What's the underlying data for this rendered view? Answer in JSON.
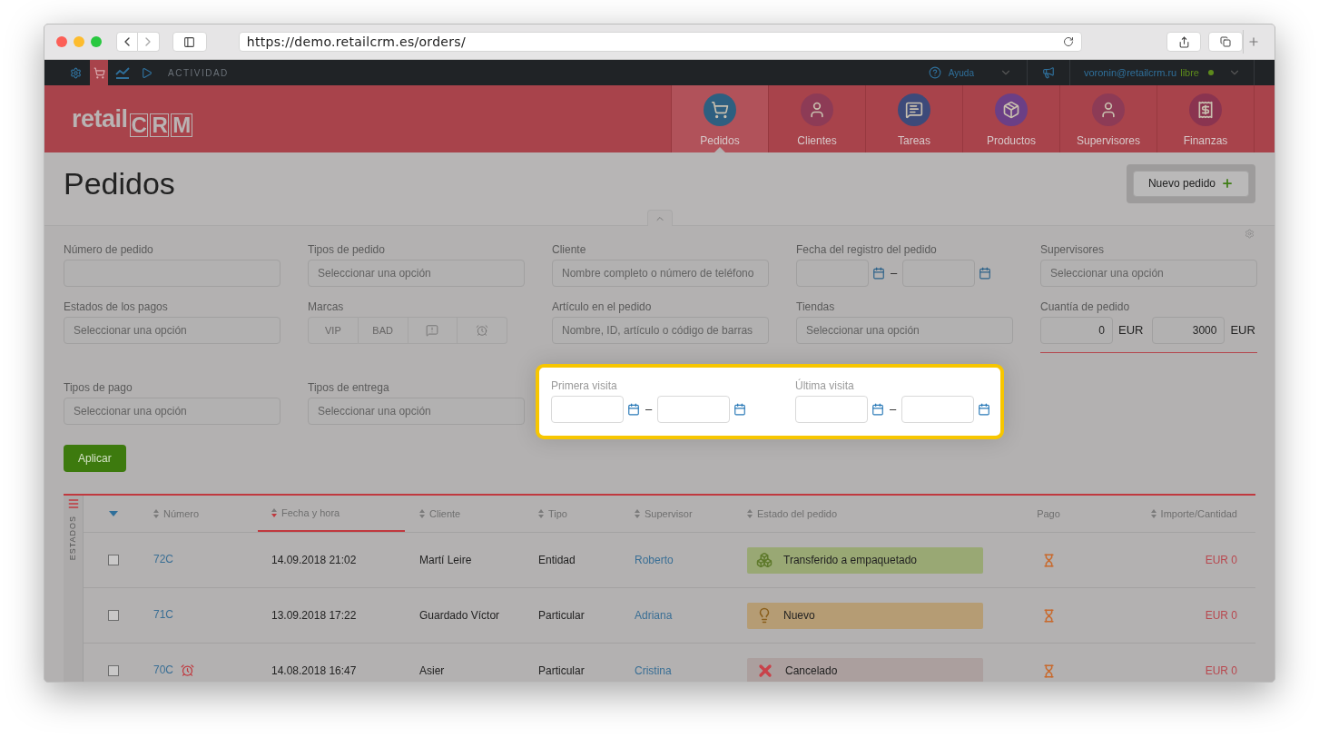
{
  "browser": {
    "url": "https://demo.retailcrm.es/orders/"
  },
  "topbar": {
    "icons": [
      {
        "kind": "gear",
        "selected": false
      },
      {
        "kind": "cart",
        "selected": true
      },
      {
        "kind": "chart",
        "selected": false
      },
      {
        "kind": "play",
        "selected": false
      }
    ],
    "activity_label": "ACTIVIDAD",
    "help": "Ayuda",
    "user_email": "voronin@retailcrm.ru",
    "user_status": "libre"
  },
  "logo": {
    "word": "retail",
    "letters": [
      "C",
      "R",
      "M"
    ]
  },
  "nav": [
    {
      "label": "Pedidos",
      "kind": "cart",
      "selected": true
    },
    {
      "label": "Clientes",
      "kind": "person",
      "selected": false
    },
    {
      "label": "Tareas",
      "kind": "chat",
      "selected": false
    },
    {
      "label": "Productos",
      "kind": "box",
      "selected": false
    },
    {
      "label": "Supervisores",
      "kind": "person",
      "selected": false
    },
    {
      "label": "Finanzas",
      "kind": "receipt",
      "selected": false
    }
  ],
  "page_title": "Pedidos",
  "new_order_button": "Nuevo pedido",
  "filters": [
    {
      "label": "Número de pedido",
      "kind": "text"
    },
    {
      "label": "Tipos de pedido",
      "kind": "select",
      "placeholder": "Seleccionar una opción"
    },
    {
      "label": "Cliente",
      "kind": "text",
      "placeholder": "Nombre completo o número de teléfono"
    },
    {
      "label": "Fecha del registro del pedido",
      "kind": "date_range",
      "separator": "–"
    },
    {
      "label": "Supervisores",
      "kind": "select",
      "placeholder": "Seleccionar una opción"
    },
    {
      "label": "Estados de los pagos",
      "kind": "select",
      "placeholder": "Seleccionar una opción"
    },
    {
      "label": "Marcas",
      "kind": "marks",
      "options": [
        {
          "kind": "text",
          "label": "VIP",
          "selected": false
        },
        {
          "kind": "text",
          "label": "BAD",
          "selected": false
        },
        {
          "kind": "flag",
          "selected": false
        },
        {
          "kind": "alarm",
          "selected": false
        }
      ]
    },
    {
      "label": "Artículo en el pedido",
      "kind": "text",
      "placeholder": "Nombre, ID, artículo o código de barras"
    },
    {
      "label": "Tiendas",
      "kind": "select",
      "placeholder": "Seleccionar una opción"
    },
    {
      "label": "Cuantía de pedido",
      "kind": "amount",
      "from": "0",
      "to": "3000",
      "currency_from": "EUR",
      "currency_to": "EUR"
    },
    {
      "label": "Tipos de pago",
      "kind": "select",
      "placeholder": "Seleccionar una opción"
    },
    {
      "label": "Tipos de entrega",
      "kind": "select",
      "placeholder": "Seleccionar una opción"
    }
  ],
  "highlighted_filters": [
    {
      "label": "Primera visita",
      "separator": "–"
    },
    {
      "label": "Última visita",
      "separator": "–"
    }
  ],
  "apply_button": "Aplicar",
  "table": {
    "side_label": "ESTADOS",
    "columns": [
      {
        "label": "Número",
        "sortable": true,
        "sorted": false
      },
      {
        "label": "Fecha y hora",
        "sortable": true,
        "sorted": true
      },
      {
        "label": "Cliente",
        "sortable": true,
        "sorted": false
      },
      {
        "label": "Tipo",
        "sortable": true,
        "sorted": false
      },
      {
        "label": "Supervisor",
        "sortable": true,
        "sorted": false
      },
      {
        "label": "Estado del pedido",
        "sortable": true,
        "sorted": false
      },
      {
        "label": "Pago",
        "sortable": false,
        "sorted": false
      },
      {
        "label": "Importe/Cantidad",
        "sortable": true,
        "sorted": false
      }
    ],
    "rows": [
      {
        "checked": false,
        "number": "72C",
        "alarm": false,
        "date": "14.09.2018 21:02",
        "client": "Martí Leire",
        "type": "Entidad",
        "supervisor": "Roberto",
        "status": {
          "label": "Transferido a empaquetado",
          "kind": "boxes",
          "color": "#99a874"
        },
        "amount": "EUR 0"
      },
      {
        "checked": false,
        "number": "71C",
        "alarm": false,
        "date": "13.09.2018 17:22",
        "client": "Guardado Víctor",
        "type": "Particular",
        "supervisor": "Adriana",
        "status": {
          "label": "Nuevo",
          "kind": "bulb",
          "color": "#b59c74"
        },
        "amount": "EUR 0"
      },
      {
        "checked": false,
        "number": "70C",
        "alarm": true,
        "date": "14.08.2018 16:47",
        "client": "Asier",
        "type": "Particular",
        "supervisor": "Cristina",
        "status": {
          "label": "Cancelado",
          "kind": "cross",
          "color": "#ab9f9e"
        },
        "amount": "EUR 0"
      }
    ]
  }
}
